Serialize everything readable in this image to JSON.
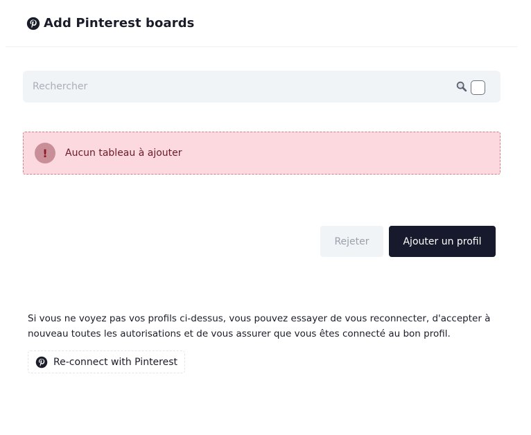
{
  "header": {
    "icon": "pinterest-icon",
    "title": "Add Pinterest boards"
  },
  "search": {
    "placeholder": "Rechercher",
    "value": "",
    "icon": "search-icon"
  },
  "select_all": {
    "checked": false
  },
  "alert": {
    "icon": "exclamation-icon",
    "text": "Aucun tableau à ajouter",
    "colors": {
      "background": "#fcd9df",
      "border": "#c9828f",
      "text": "#6a1a26"
    }
  },
  "actions": {
    "reject_label": "Rejeter",
    "add_label": "Ajouter un profil"
  },
  "help": {
    "text": "Si vous ne voyez pas vos profils ci-dessus, vous pouvez essayer de vous reconnecter, d'accepter à nouveau toutes les autorisations et de vous assurer que vous êtes connecté au bon profil."
  },
  "reconnect": {
    "icon": "pinterest-icon",
    "label": "Re-connect with Pinterest"
  },
  "colors": {
    "primary_button": "#161a2c",
    "secondary_button": "#f1f4f7",
    "search_background": "#f1f4f7"
  }
}
